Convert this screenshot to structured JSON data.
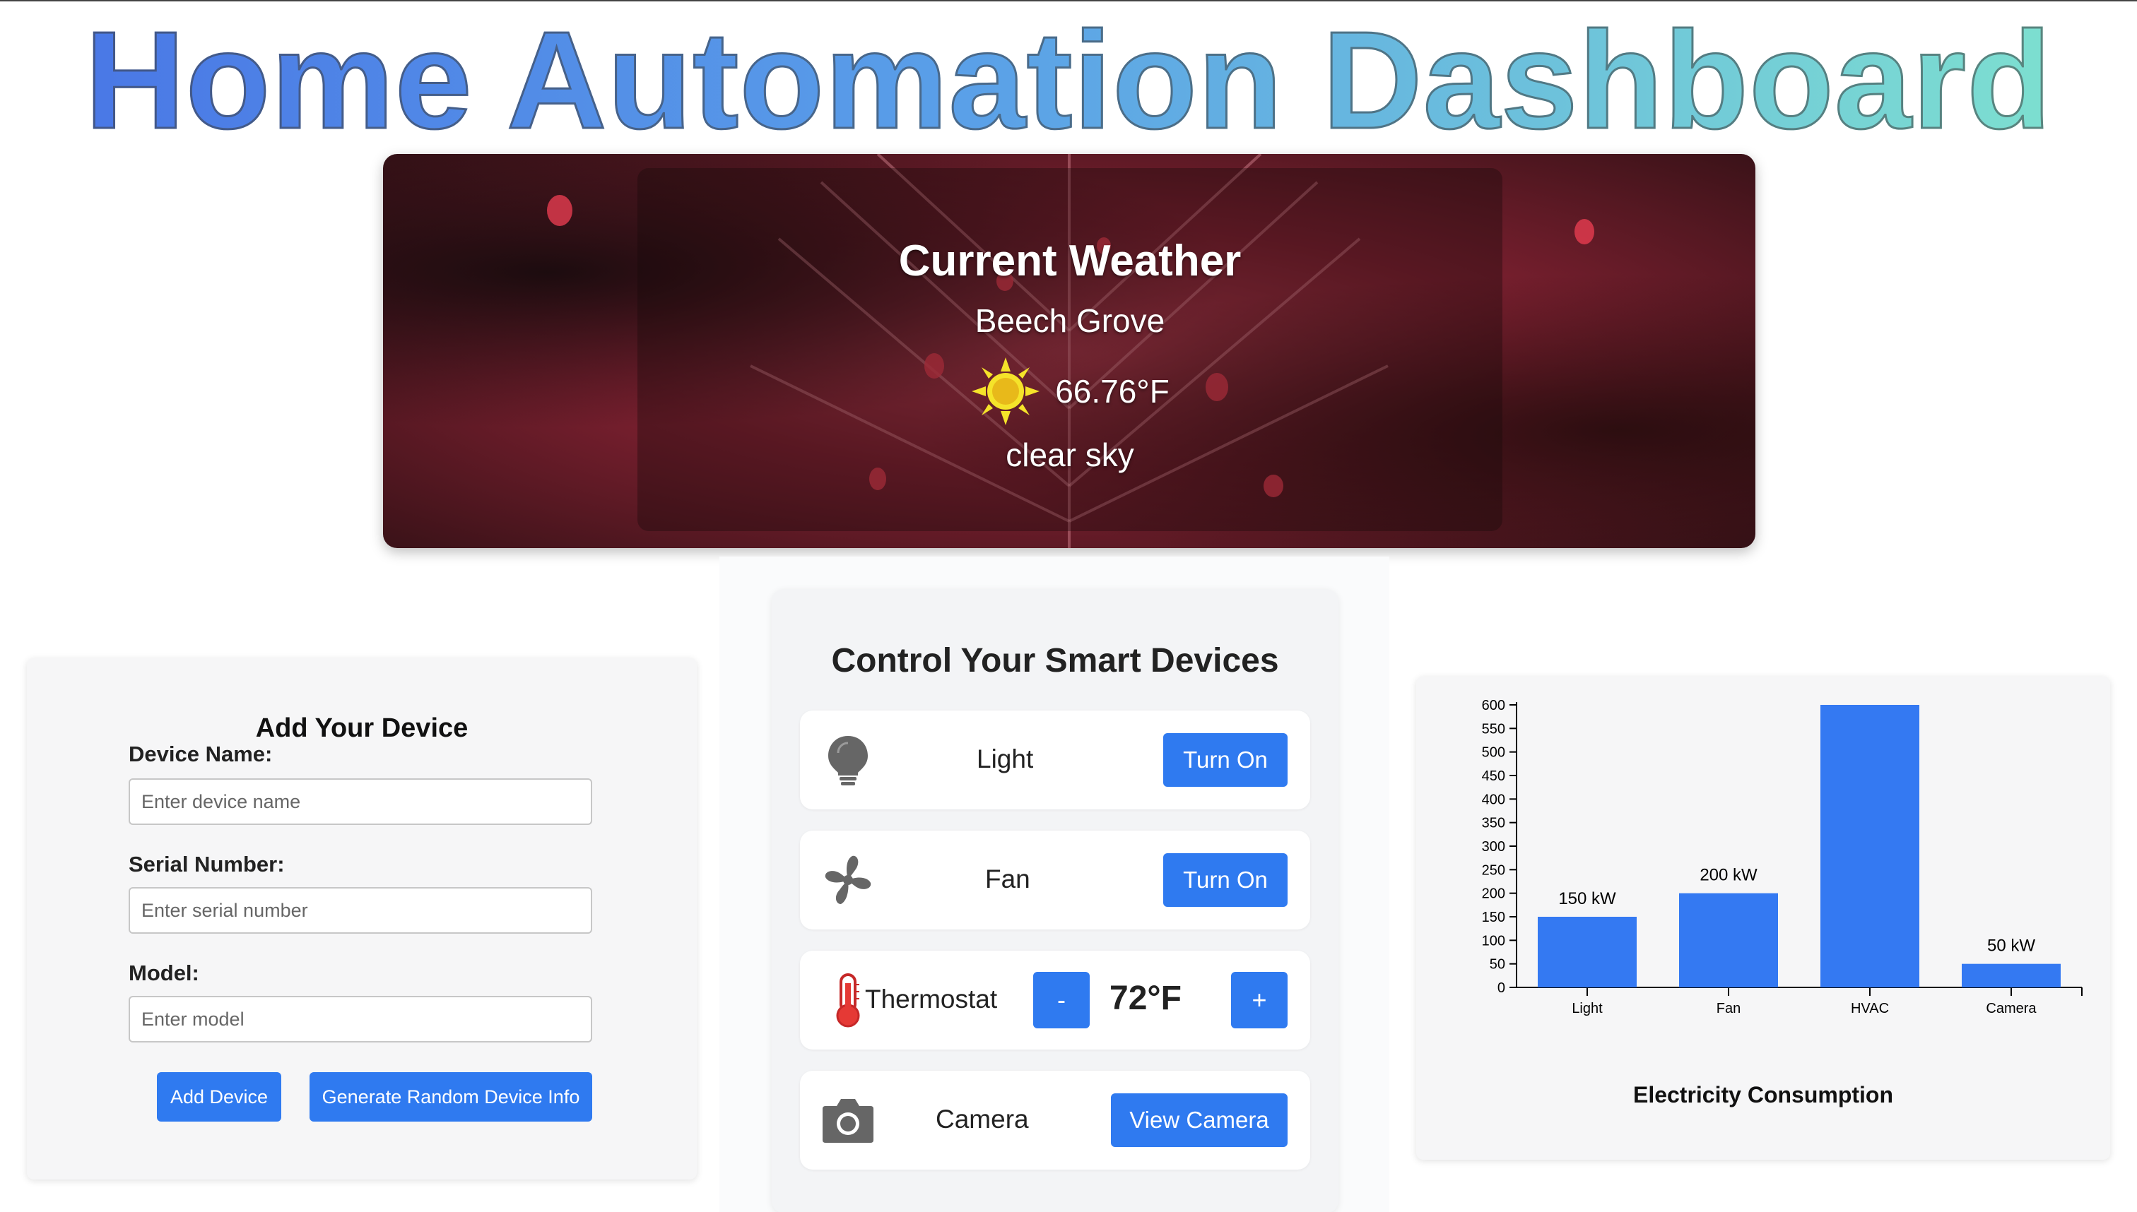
{
  "header": {
    "title": "Home Automation Dashboard"
  },
  "weather": {
    "heading": "Current Weather",
    "city": "Beech Grove",
    "temperature": "66.76°F",
    "description": "clear sky",
    "icon": "sun-icon"
  },
  "add_device": {
    "title": "Add Your Device",
    "name_label": "Device Name:",
    "name_placeholder": "Enter device name",
    "serial_label": "Serial Number:",
    "serial_placeholder": "Enter serial number",
    "model_label": "Model:",
    "model_placeholder": "Enter model",
    "add_button": "Add Device",
    "random_button": "Generate Random Device Info"
  },
  "controls": {
    "title": "Control Your Smart Devices",
    "devices": [
      {
        "name": "Light",
        "icon": "lightbulb-icon",
        "action": "Turn On"
      },
      {
        "name": "Fan",
        "icon": "fan-icon",
        "action": "Turn On"
      },
      {
        "name": "Thermostat",
        "icon": "thermometer-icon",
        "decrease": "-",
        "value": "72°F",
        "increase": "+"
      },
      {
        "name": "Camera",
        "icon": "camera-icon",
        "action": "View Camera"
      }
    ]
  },
  "colors": {
    "accent": "#2f7af0",
    "bar": "#3479f2"
  },
  "chart_data": {
    "type": "bar",
    "categories": [
      "Light",
      "Fan",
      "HVAC",
      "Camera"
    ],
    "values": [
      150,
      200,
      600,
      50
    ],
    "data_labels": [
      "150 kW",
      "200 kW",
      "",
      "50 kW"
    ],
    "yticks": [
      0,
      50,
      100,
      150,
      200,
      250,
      300,
      350,
      400,
      450,
      500,
      550,
      600
    ],
    "ytick_labels": [
      "0",
      "50",
      "100",
      "150",
      "200",
      "250",
      "300",
      "350",
      "400",
      "450",
      "500",
      "550",
      "600"
    ],
    "ylim": [
      0,
      600
    ],
    "caption": "Electricity Consumption",
    "grid": false
  }
}
